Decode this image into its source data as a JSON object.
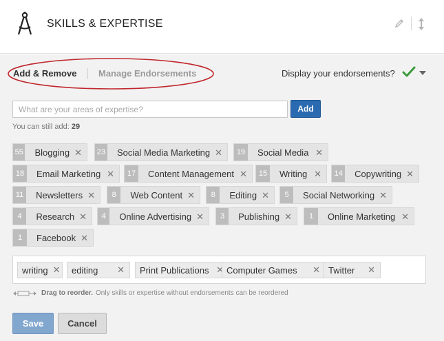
{
  "header": {
    "title": "SKILLS & EXPERTISE",
    "icon": "compass-icon",
    "edit_icon": "pencil-icon",
    "reorder_icon": "up-down-arrows-icon"
  },
  "tabs": {
    "add_remove": "Add & Remove",
    "manage_endorsements": "Manage Endorsements",
    "highlight_color": "#c0272d"
  },
  "display_endorsements": {
    "label": "Display your endorsements?",
    "check_color": "#3a9a3a"
  },
  "input": {
    "placeholder": "What are your areas of expertise?",
    "value": "",
    "add_label": "Add"
  },
  "remaining": {
    "prefix": "You can still add:",
    "count": "29"
  },
  "endorsed_skills": [
    {
      "count": "55",
      "name": "Blogging"
    },
    {
      "count": "23",
      "name": "Social Media Marketing"
    },
    {
      "count": "19",
      "name": "Social Media"
    },
    {
      "count": "18",
      "name": "Email Marketing"
    },
    {
      "count": "17",
      "name": "Content Management"
    },
    {
      "count": "15",
      "name": "Writing"
    },
    {
      "count": "14",
      "name": "Copywriting"
    },
    {
      "count": "11",
      "name": "Newsletters"
    },
    {
      "count": "8",
      "name": "Web Content"
    },
    {
      "count": "8",
      "name": "Editing"
    },
    {
      "count": "5",
      "name": "Social Networking"
    },
    {
      "count": "4",
      "name": "Research"
    },
    {
      "count": "4",
      "name": "Online Advertising"
    },
    {
      "count": "3",
      "name": "Publishing"
    },
    {
      "count": "1",
      "name": "Online Marketing"
    },
    {
      "count": "1",
      "name": "Facebook"
    }
  ],
  "unendorsed_skills": [
    "writing",
    "editing",
    "Print Publications",
    "Computer Games",
    "Twitter"
  ],
  "remove_glyph": "✕",
  "drag_hint": {
    "bold": "Drag to reorder.",
    "rest": "Only skills or expertise without endorsements can be reordered"
  },
  "buttons": {
    "save": "Save",
    "cancel": "Cancel"
  }
}
